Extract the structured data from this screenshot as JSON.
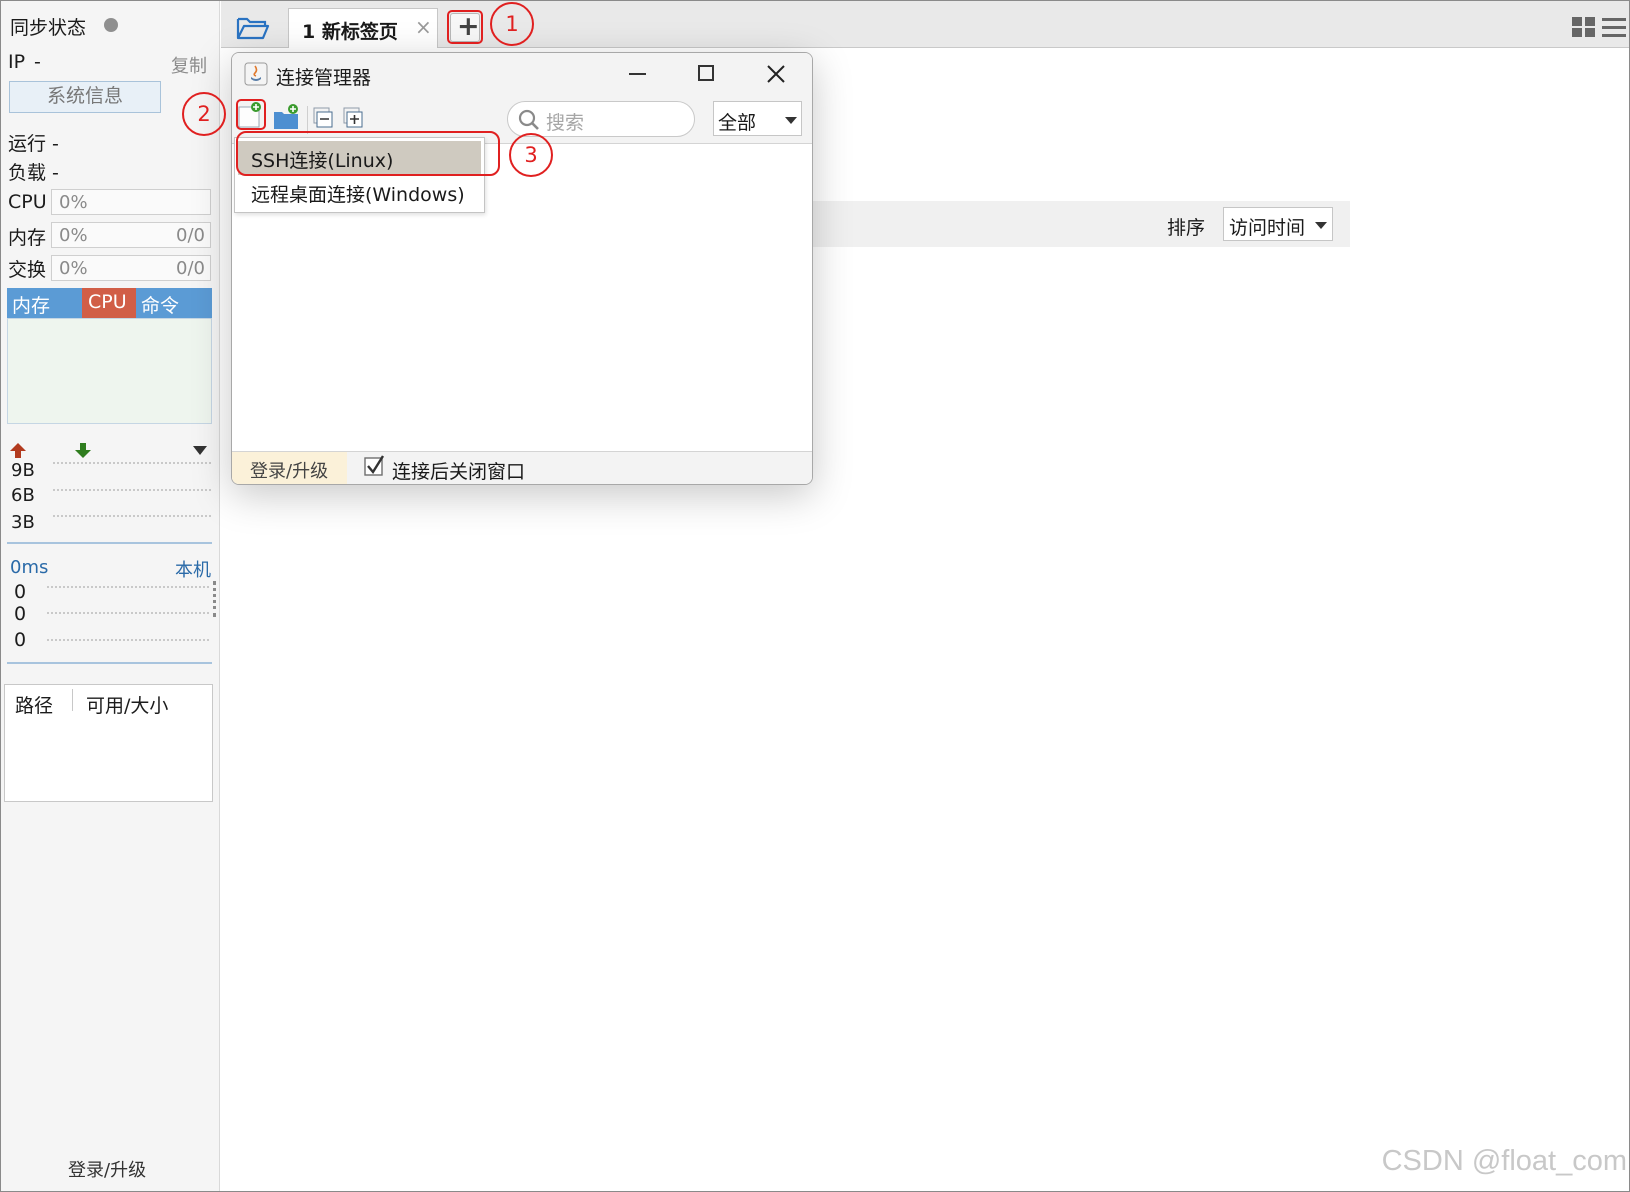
{
  "sidebar": {
    "sync_label": "同步状态",
    "ip_label": "IP",
    "ip_value": "-",
    "copy_label": "复制",
    "sysinfo_button": "系统信息",
    "run_label": "运行 -",
    "load_label": "负载 -",
    "cpu": {
      "label": "CPU",
      "percent": "0%"
    },
    "mem": {
      "label": "内存",
      "percent": "0%",
      "ratio": "0/0"
    },
    "swap": {
      "label": "交换",
      "percent": "0%",
      "ratio": "0/0"
    },
    "process_table": {
      "headers": [
        "内存",
        "CPU",
        "命令"
      ]
    },
    "net_chart": {
      "ticks": [
        "9B",
        "6B",
        "3B"
      ]
    },
    "latency": {
      "value": "0ms",
      "host": "本机",
      "ticks": [
        "0",
        "0",
        "0"
      ]
    },
    "disk_table": {
      "headers": [
        "路径",
        "可用/大小"
      ]
    },
    "footer_link": "登录/升级",
    "colors": {
      "process_header": "#5b9bd5",
      "cpu_column": "#d15e47",
      "status_dot": "#8f8f8f"
    }
  },
  "tabbar": {
    "folder_icon": "folder-open-icon",
    "tab_title": "1 新标签页",
    "close_glyph": "×",
    "add_glyph": "+",
    "layout_icon": "grid-icon",
    "menu_icon": "hamburger-icon"
  },
  "content": {
    "sort_label": "排序",
    "sort_value": "访问时间"
  },
  "dialog": {
    "title": "连接管理器",
    "search_placeholder": "搜索",
    "filter_value": "全部",
    "menu_items": [
      "SSH连接(Linux)",
      "远程桌面连接(Windows)"
    ],
    "footer_link": "登录/升级",
    "close_after_connect_label": "连接后关闭窗口",
    "close_after_connect_checked": true
  },
  "annotations": [
    "1",
    "2",
    "3"
  ],
  "watermark": "CSDN @float_com"
}
